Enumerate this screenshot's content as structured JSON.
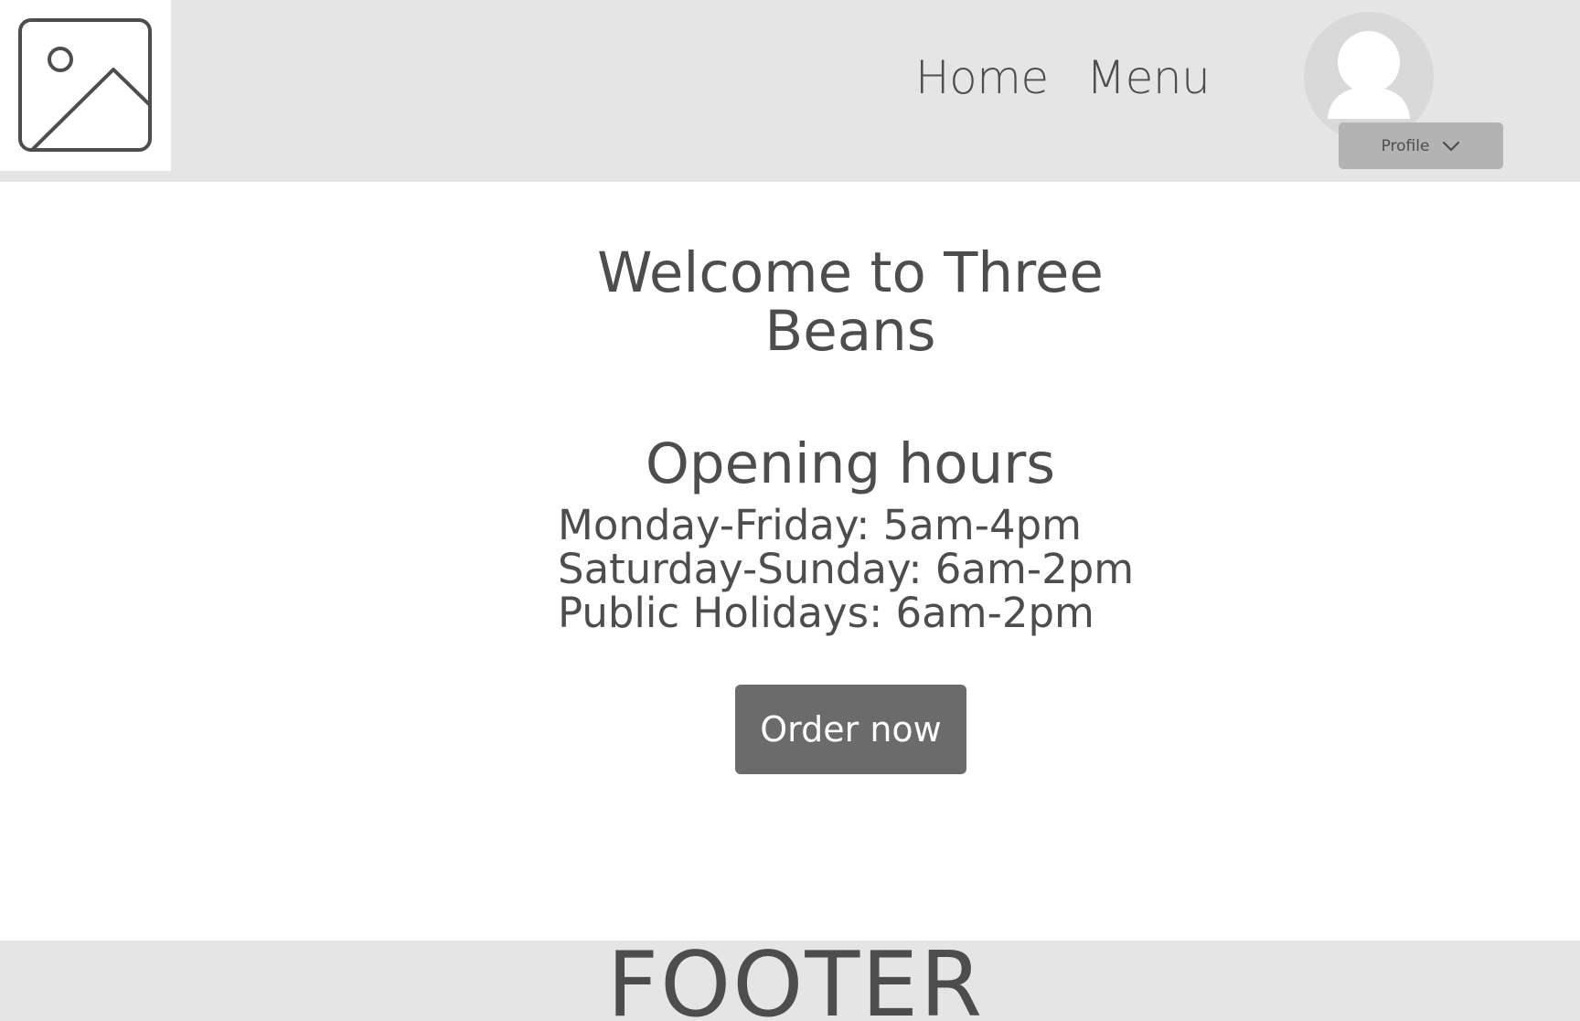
{
  "header": {
    "logo_icon": "image-placeholder-icon",
    "nav": [
      {
        "label": "Home"
      },
      {
        "label": "Menu"
      }
    ],
    "avatar_icon": "user-avatar-icon",
    "profile": {
      "label": "Profile",
      "icon": "chevron-down-icon"
    }
  },
  "main": {
    "title": "Welcome to Three Beans",
    "hours_title": "Opening hours",
    "hours": [
      "Monday-Friday: 5am-4pm",
      "Saturday-Sunday: 6am-2pm",
      "Public Holidays: 6am-2pm"
    ],
    "order_button": "Order now"
  },
  "footer": {
    "text": "FOOTER"
  },
  "colors": {
    "header_bg": "#e5e5e5",
    "text": "#4d4d4d",
    "profile_button_bg": "#b3b3b3",
    "order_button_bg": "#6b6b6b",
    "avatar_bg": "#d9d9d9"
  }
}
